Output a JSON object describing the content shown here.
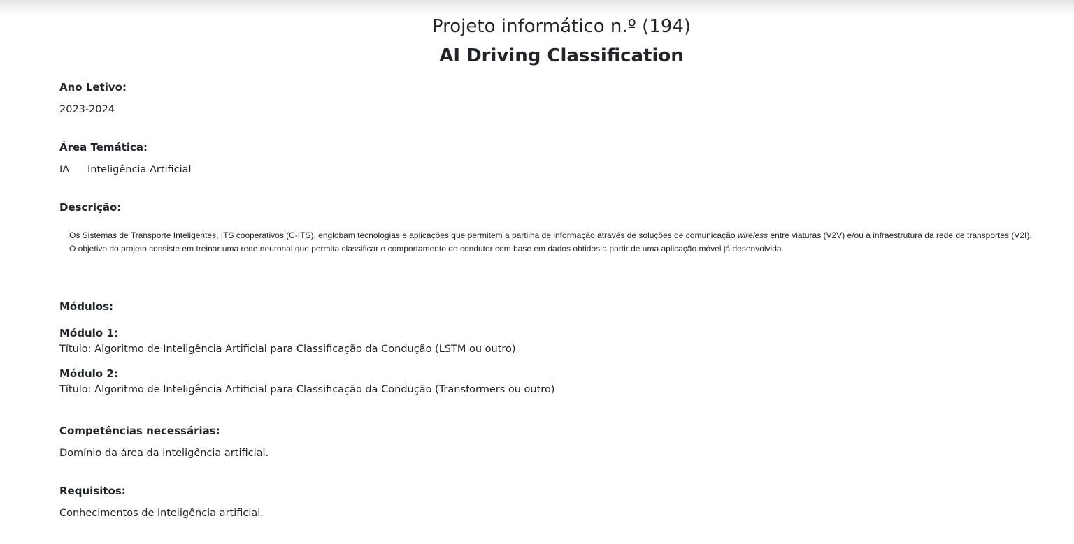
{
  "header": {
    "line1": "Projeto informático n.º (194)",
    "line2": "AI Driving Classification"
  },
  "ano_letivo": {
    "label": "Ano Letivo:",
    "value": "2023-2024"
  },
  "area_tematica": {
    "label": "Área Temática:",
    "code": "IA",
    "name": "Inteligência Artificial"
  },
  "descricao": {
    "label": "Descrição:",
    "p1_before": "Os Sistemas de Transporte Inteligentes, ITS cooperativos (C-ITS), englobam tecnologias e aplicações que permitem a partilha de informação através de soluções de comunicação ",
    "p1_em": "wireless",
    "p1_after": " entre viaturas (V2V) e/ou a infraestrutura da rede de transportes (V2I).",
    "p2": "O objetivo do projeto consiste em treinar uma rede neuronal que permita classificar o comportamento do condutor com base em dados obtidos a partir de uma aplicação móvel já desenvolvida."
  },
  "modulos": {
    "label": "Módulos:",
    "items": [
      {
        "name": "Módulo 1:",
        "title": "Título: Algoritmo de Inteligência Artificial para Classificação da Condução (LSTM ou outro)"
      },
      {
        "name": "Módulo 2:",
        "title": "Título: Algoritmo de Inteligência Artificial para Classificação da Condução (Transformers ou outro)"
      }
    ]
  },
  "competencias": {
    "label": "Competências necessárias:",
    "value": "Domínio da área da inteligência artificial."
  },
  "requisitos": {
    "label": "Requisitos:",
    "value": "Conhecimentos de inteligência artificial."
  }
}
